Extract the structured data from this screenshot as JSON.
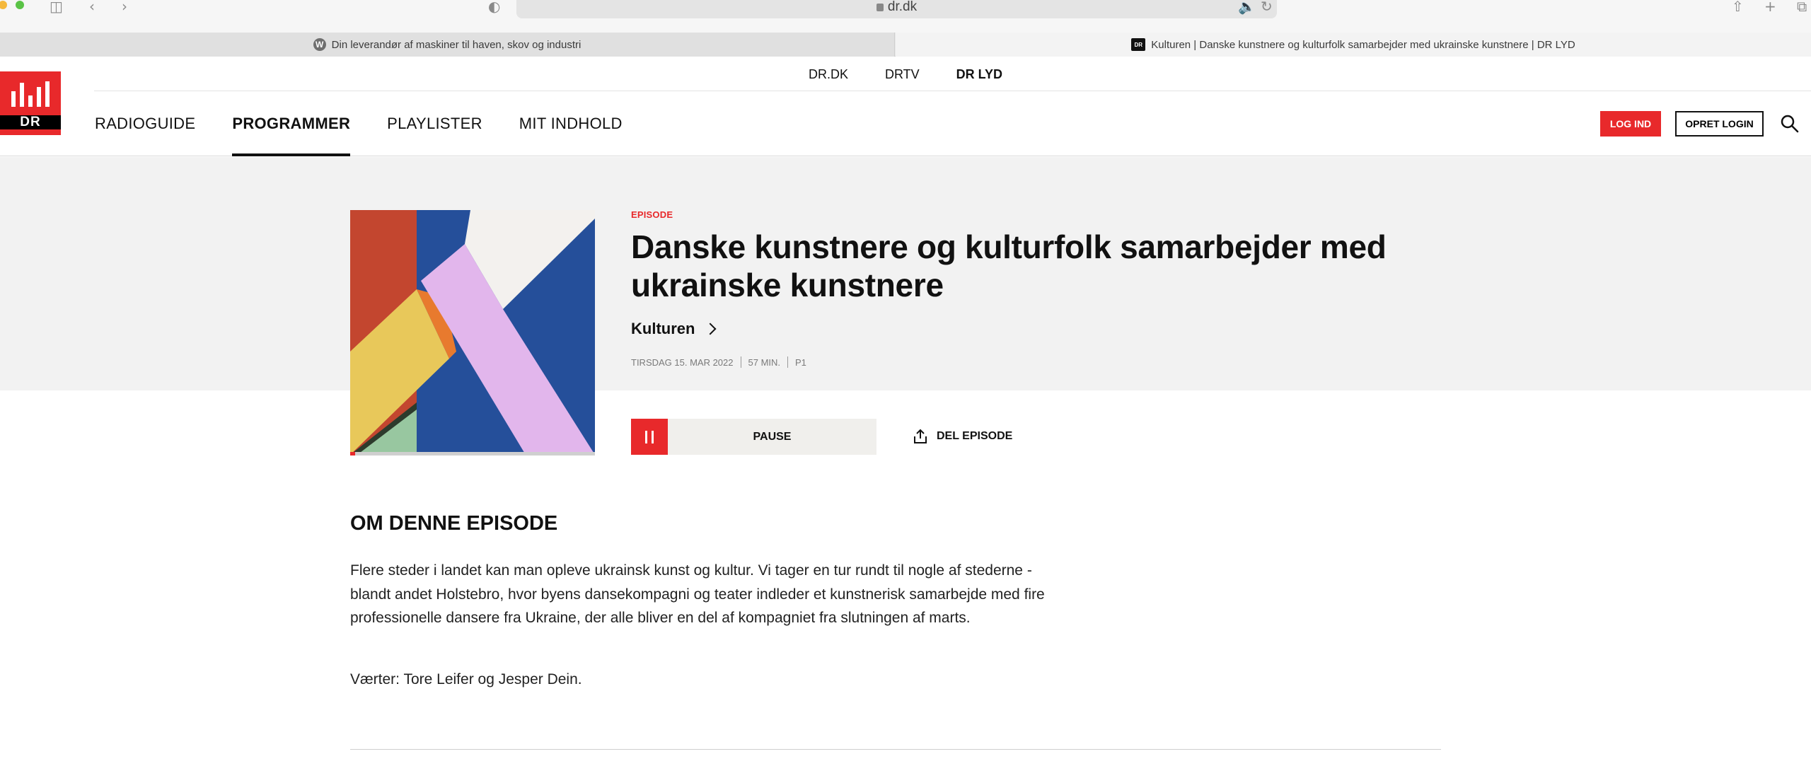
{
  "browser": {
    "url": "dr.dk",
    "tabs": [
      {
        "label": "Din leverandør af maskiner til haven, skov og industri",
        "favicon": "wordpress-icon"
      },
      {
        "label": "Kulturen | Danske kunstnere og kulturfolk samarbejder med ukrainske kunstnere | DR LYD",
        "favicon": "dr-icon"
      }
    ]
  },
  "header": {
    "logo_text": "DR",
    "topnav": [
      "DR.DK",
      "DRTV",
      "DR LYD"
    ],
    "mainnav": [
      "RADIOGUIDE",
      "PROGRAMMER",
      "PLAYLISTER",
      "MIT INDHOLD"
    ],
    "login_label": "LOG IND",
    "create_login_label": "OPRET LOGIN"
  },
  "episode": {
    "label": "EPISODE",
    "title": "Danske kunstnere og kulturfolk samarbejder med ukrainske kunstnere",
    "series": "Kulturen",
    "date": "TIRSDAG 15. MAR 2022",
    "duration": "57 MIN.",
    "channel": "P1",
    "play_state_label": "PAUSE",
    "share_label": "DEL EPISODE",
    "progress_fraction": 0.02
  },
  "about": {
    "title": "OM DENNE EPISODE",
    "description": "Flere steder i landet kan man opleve ukrainsk kunst og kultur. Vi tager en tur rundt til nogle af stederne - blandt andet Holstebro, hvor byens dansekompagni og teater indleder et kunstnerisk samarbejde med fire professionelle dansere fra Ukraine, der alle bliver en del af kompagniet fra slutningen af marts.",
    "hosts": "Værter: Tore Leifer og Jesper Dein."
  },
  "colors": {
    "brand_red": "#e8292b",
    "hero_bg": "#f2f2f2"
  }
}
